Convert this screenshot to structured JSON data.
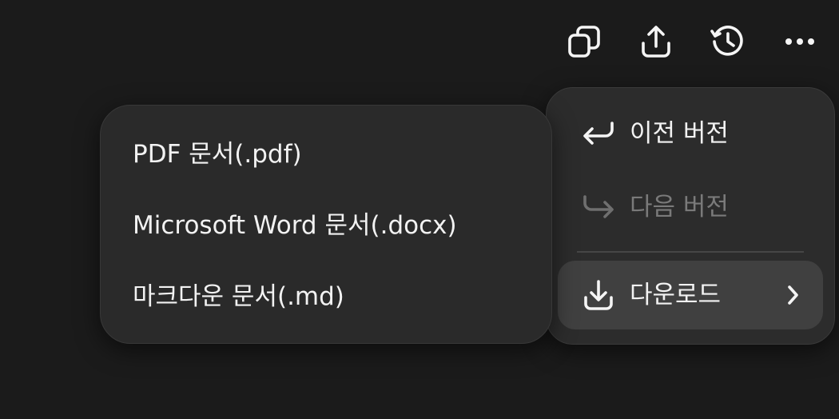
{
  "toolbar": {
    "icons": [
      "copy-icon",
      "share-icon",
      "history-icon",
      "more-icon"
    ]
  },
  "menu": {
    "items": [
      {
        "label": "이전 버전",
        "icon": "undo-arrow-icon",
        "enabled": true
      },
      {
        "label": "다음 버전",
        "icon": "redo-arrow-icon",
        "enabled": false
      },
      {
        "label": "다운로드",
        "icon": "download-icon",
        "enabled": true,
        "has_submenu": true,
        "active": true
      }
    ]
  },
  "submenu": {
    "items": [
      {
        "label": "PDF 문서(.pdf)"
      },
      {
        "label": "Microsoft Word 문서(.docx)"
      },
      {
        "label": "마크다운 문서(.md)"
      }
    ]
  },
  "colors": {
    "background": "#1b1b1b",
    "menu": "#2c2c2c",
    "active_item": "#404040",
    "text": "#f2f2f2",
    "disabled_text": "#7a7a7a"
  }
}
